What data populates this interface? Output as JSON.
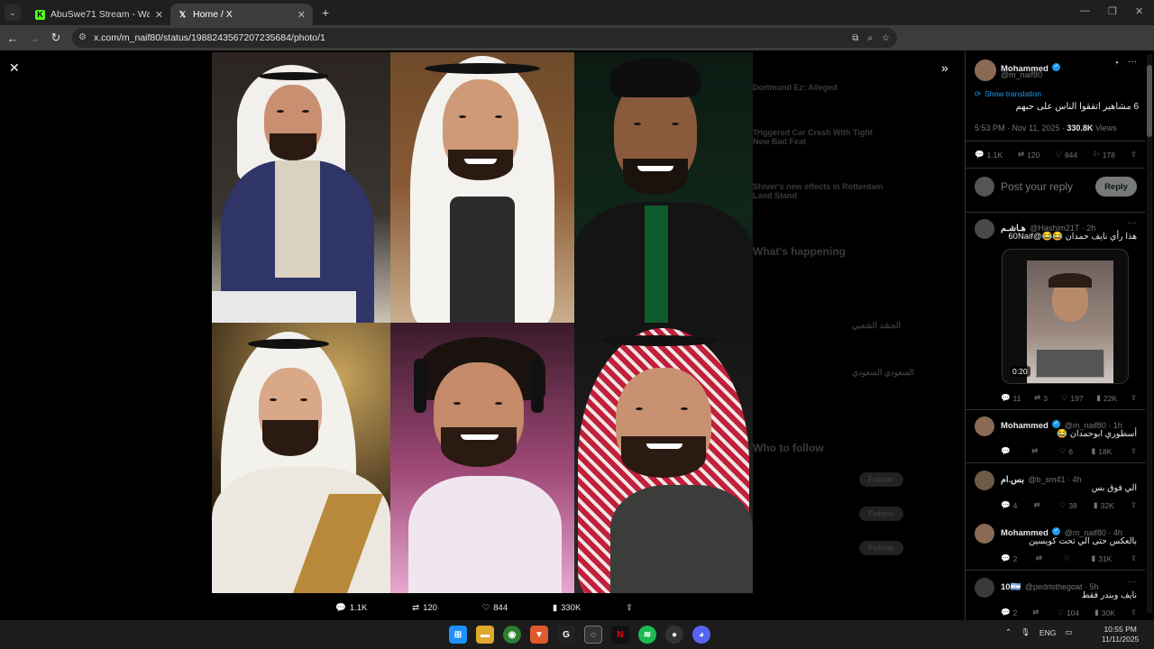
{
  "browser": {
    "tabs": [
      {
        "title": "AbuSwe71 Stream - Watch Live",
        "favicon": "kick-icon",
        "color": "#53fc18",
        "active": false
      },
      {
        "title": "Home / X",
        "favicon": "x-icon",
        "color": "#ffffff",
        "active": true
      }
    ],
    "new_tab": "+",
    "url": "x.com/m_naif80/status/1988243567207235684/photo/1"
  },
  "media_viewer": {
    "close": "✕",
    "expand": "»",
    "actions": {
      "replies": "1.1K",
      "reposts": "120",
      "likes": "844",
      "views": "330K"
    },
    "background_feed": [
      "Dortmund Ez: Alleged",
      "Triggered Car Crash With Tight New Bad Feat",
      "Shiver's new effects in Rotterdam Land Stand",
      "What's happening",
      "السعودي السعودي",
      "الحشد الشعبي",
      "Who to follow",
      "Follow",
      "Follow",
      "Follow"
    ]
  },
  "tweet": {
    "author_name": "Mohammed",
    "author_handle": "@m_naif80",
    "show_translation": "Show translation",
    "text": "6 مشاهير اتفقوا الناس على حبهم",
    "time": "5:53 PM · Nov 11, 2025 ·",
    "views_count": "330.8K",
    "views_label": "Views",
    "stats": {
      "replies": "1.1K",
      "reposts": "120",
      "likes": "844",
      "bookmarks": "178"
    },
    "reply_placeholder": "Post your reply",
    "reply_button": "Reply"
  },
  "replies": [
    {
      "name": "هـاشـم",
      "handle": "@Hashim21T · 2h",
      "text": "هذا رأي نايف حمدان 😂😂@60Naif",
      "video_duration": "0:20",
      "stats": {
        "replies": "11",
        "reposts": "3",
        "likes": "197",
        "views": "22K"
      }
    },
    {
      "name": "Mohammed",
      "handle": "@m_naif80 · 1h",
      "text": "أسطوري ابوحمدان 😂",
      "stats": {
        "replies": "",
        "reposts": "",
        "likes": "6",
        "views": "18K"
      }
    },
    {
      "name": "بس.ام",
      "handle": "@b_sm41 · 4h",
      "text": "الي فوق بس",
      "stats": {
        "replies": "4",
        "reposts": "",
        "likes": "38",
        "views": "32K"
      }
    },
    {
      "name": "Mohammed",
      "handle": "@m_naif80 · 4h",
      "text": "بالعكس حتى الي تحت كويسين",
      "stats": {
        "replies": "2",
        "reposts": "",
        "likes": "",
        "views": "31K"
      }
    },
    {
      "name": "10🇦🇷",
      "handle": "@pedrlsthegoat · 5h",
      "text": "نايف وبندر فقط",
      "stats": {
        "replies": "2",
        "reposts": "",
        "likes": "104",
        "views": "30K"
      }
    }
  ],
  "taskbar": {
    "lang": "ENG",
    "time": "10:55 PM",
    "date": "11/11/2025"
  }
}
